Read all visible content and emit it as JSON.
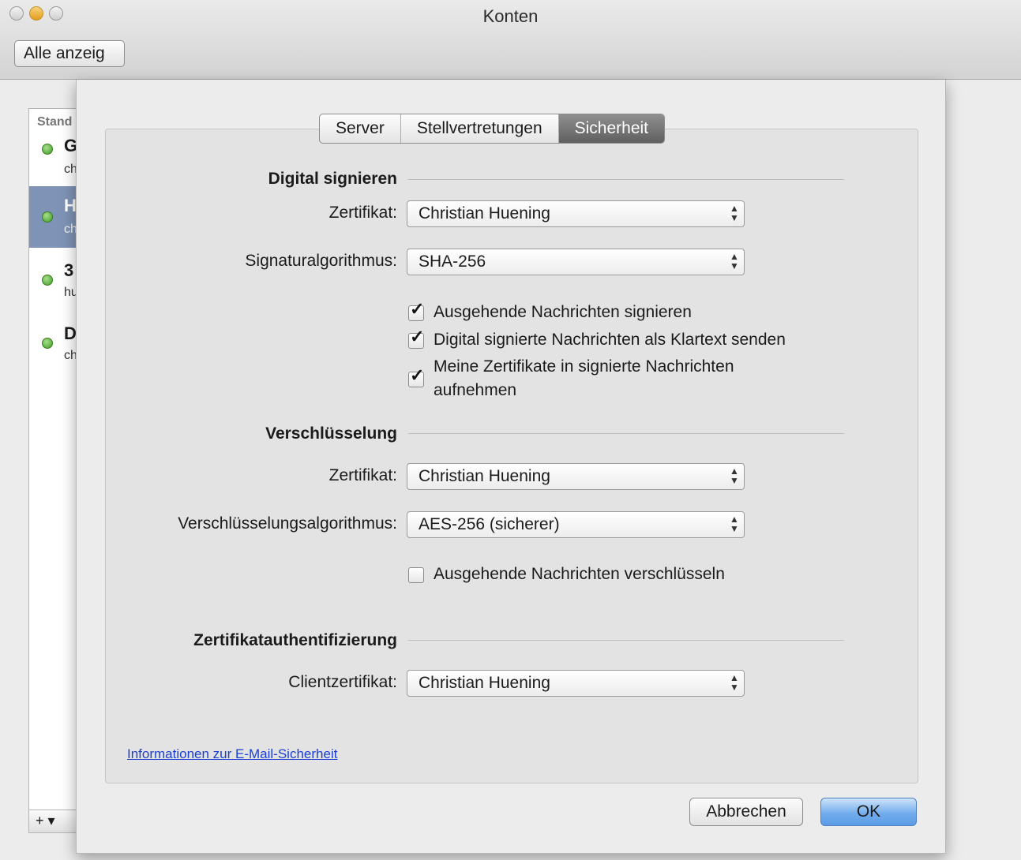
{
  "window": {
    "title": "Konten",
    "show_all_label": "Alle anzeig"
  },
  "accounts": {
    "header": "Stand",
    "items": [
      {
        "name": "G",
        "email": "ch"
      },
      {
        "name": "H",
        "email": "ch"
      },
      {
        "name": "3",
        "email": "hu"
      },
      {
        "name": "D",
        "email": "ch"
      }
    ],
    "add_label": "+ ▾"
  },
  "tabs": [
    {
      "label": "Server",
      "active": false
    },
    {
      "label": "Stellvertretungen",
      "active": false
    },
    {
      "label": "Sicherheit",
      "active": true
    }
  ],
  "sign": {
    "heading": "Digital signieren",
    "cert_label": "Zertifikat:",
    "cert_value": "Christian Huening",
    "algo_label": "Signaturalgorithmus:",
    "algo_value": "SHA-256",
    "opt1": "Ausgehende Nachrichten signieren",
    "opt1_checked": true,
    "opt2": "Digital signierte Nachrichten als Klartext senden",
    "opt2_checked": true,
    "opt3_line1": "Meine Zertifikate in signierte Nachrichten",
    "opt3_line2": "aufnehmen",
    "opt3_checked": true
  },
  "encrypt": {
    "heading": "Verschlüsselung",
    "cert_label": "Zertifikat:",
    "cert_value": "Christian Huening",
    "algo_label": "Verschlüsselungsalgorithmus:",
    "algo_value": "AES-256 (sicherer)",
    "opt1": "Ausgehende Nachrichten verschlüsseln",
    "opt1_checked": false
  },
  "certauth": {
    "heading": "Zertifikatauthentifizierung",
    "client_label": "Clientzertifikat:",
    "client_value": "Christian Huening"
  },
  "footer": {
    "info_link": "Informationen zur E-Mail-Sicherheit",
    "cancel": "Abbrechen",
    "ok": "OK"
  },
  "colors": {
    "accent": "#5a9ce6",
    "selected_row": "#7e93b6",
    "link": "#1a3fd2"
  }
}
